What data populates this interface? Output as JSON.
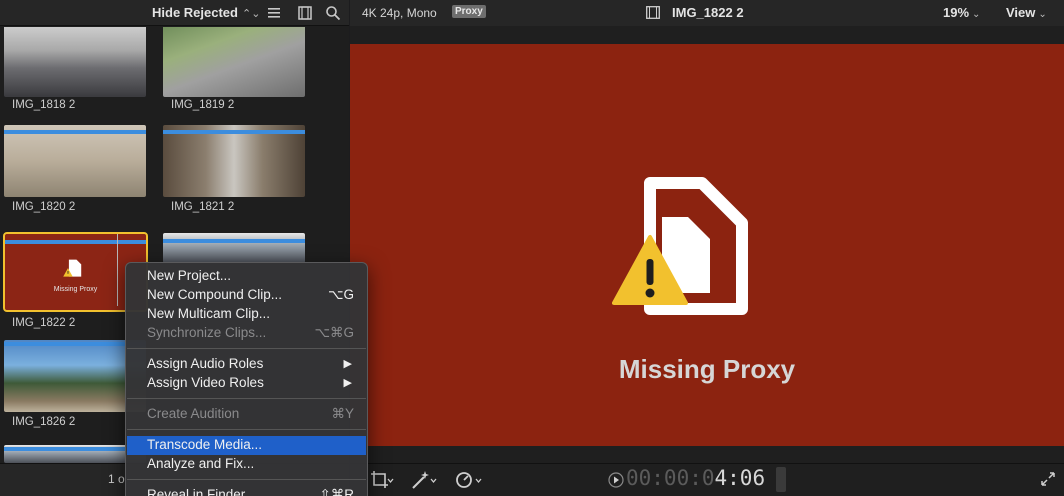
{
  "browser": {
    "filter_label": "Hide Rejected",
    "clips": [
      {
        "name": "IMG_1818 2"
      },
      {
        "name": "IMG_1819 2"
      },
      {
        "name": "IMG_1820 2"
      },
      {
        "name": "IMG_1821 2"
      },
      {
        "name": "IMG_1822 2",
        "placeholder_text": "Missing Proxy"
      },
      {
        "name": "IMG_1826 2"
      }
    ],
    "count_text": "1 o"
  },
  "viewer": {
    "format": "4K 24p, Mono",
    "proxy_badge": "Proxy",
    "clip_title": "IMG_1822 2",
    "zoom": "19%",
    "view_label": "View",
    "placeholder_text": "Missing Proxy",
    "timecode_dim": "00:00:0",
    "timecode_lit": "4:06"
  },
  "context_menu": {
    "items": [
      {
        "label": "New Project...",
        "shortcut": ""
      },
      {
        "label": "New Compound Clip...",
        "shortcut": "⌥G"
      },
      {
        "label": "New Multicam Clip...",
        "shortcut": ""
      },
      {
        "label": "Synchronize Clips...",
        "shortcut": "⌥⌘G",
        "disabled": true
      },
      {
        "label": "Assign Audio Roles",
        "submenu": true
      },
      {
        "label": "Assign Video Roles",
        "submenu": true
      },
      {
        "label": "Create Audition",
        "shortcut": "⌘Y",
        "disabled": true
      },
      {
        "label": "Transcode Media...",
        "shortcut": "",
        "highlighted": true
      },
      {
        "label": "Analyze and Fix...",
        "shortcut": ""
      },
      {
        "label": "Reveal in Finder",
        "shortcut": "⇧⌘R"
      }
    ]
  },
  "colors": {
    "missing_proxy_bg": "#8c2310",
    "warning_yellow": "#f2c12e",
    "menu_highlight": "#1f60c9",
    "range_marker": "#3c8dde"
  }
}
